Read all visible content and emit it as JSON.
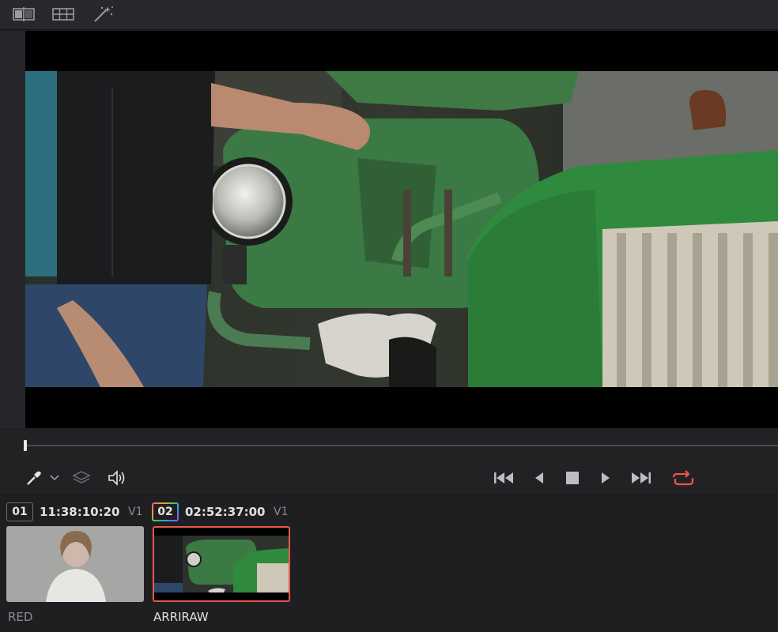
{
  "toolbar": {
    "icons": [
      "split-screen-icon",
      "grid-icon",
      "magic-wand-icon"
    ]
  },
  "transport": {
    "left_icons": [
      "eyedropper-icon",
      "chevron-down-icon",
      "layers-icon",
      "speaker-icon"
    ],
    "buttons": [
      "skip-to-start-icon",
      "step-back-icon",
      "stop-icon",
      "play-icon",
      "skip-to-end-icon",
      "loop-icon"
    ]
  },
  "clips": [
    {
      "number": "01",
      "timecode": "11:38:10:20",
      "track": "V1",
      "label": "RED",
      "selected": false
    },
    {
      "number": "02",
      "timecode": "02:52:37:00",
      "track": "V1",
      "label": "ARRIRAW",
      "selected": true
    }
  ],
  "colors": {
    "accent_red": "#e8584a",
    "panel": "#1f1f22",
    "toolbar": "#28282c"
  }
}
